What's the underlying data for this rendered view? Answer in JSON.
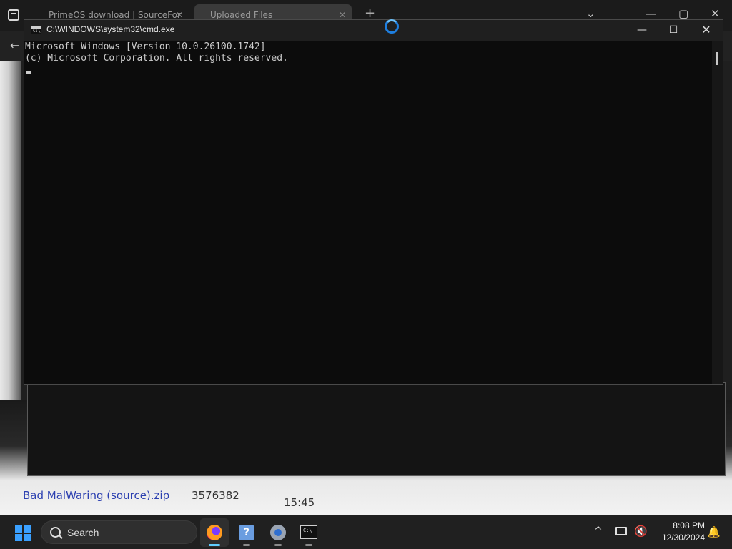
{
  "browser": {
    "tabs": [
      {
        "label": "PrimeOS download | SourceFor"
      },
      {
        "label": "Uploaded Files"
      }
    ],
    "new_tab": "+",
    "controls": {
      "tab_list": "⌄",
      "minimize": "—",
      "maximize": "▢",
      "close": "✕"
    },
    "back": "←",
    "file": {
      "name": "Bad MalWaring (source).zip",
      "size": "3576382",
      "time": "15:45"
    }
  },
  "cmd": {
    "title": "C:\\WINDOWS\\system32\\cmd.exe",
    "icon_text": "C:\\",
    "controls": {
      "minimize": "—",
      "maximize": "☐",
      "close": "✕"
    },
    "lines": [
      "Microsoft Windows [Version 10.0.26100.1742]",
      "(c) Microsoft Corporation. All rights reserved."
    ]
  },
  "taskbar": {
    "search_label": "Search",
    "apps": [
      {
        "name": "firefox",
        "active": true
      },
      {
        "name": "help"
      },
      {
        "name": "settings"
      },
      {
        "name": "terminal"
      }
    ],
    "help_glyph": "?",
    "terminal_glyph": "C:\\_",
    "tray": {
      "chevron": "^",
      "volume": "🔇"
    },
    "clock": {
      "time": "8:08 PM",
      "date": "12/30/2024"
    },
    "bell": "🔔"
  }
}
